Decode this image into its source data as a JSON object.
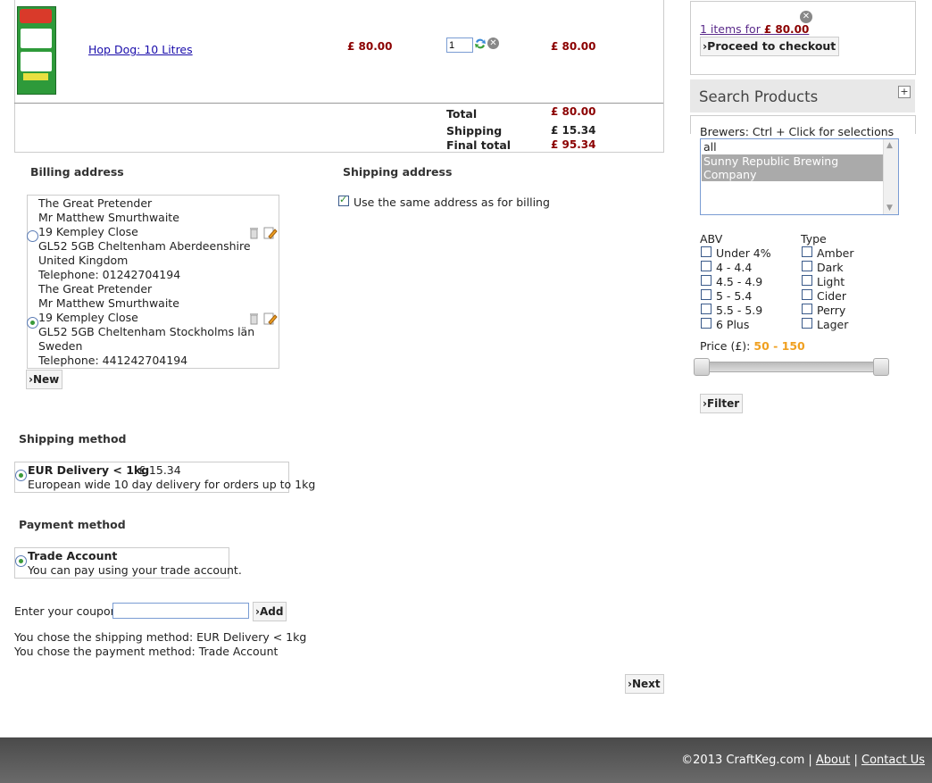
{
  "cart": {
    "product_link": "Hop Dog: 10 Litres",
    "unit_price": "£ 80.00",
    "quantity": "1",
    "line_total": "£ 80.00",
    "totals": [
      {
        "label": "Total",
        "value": "£ 80.00"
      },
      {
        "label": "Shipping",
        "value": "£ 15.34"
      },
      {
        "label": "Final total",
        "value": "£ 95.34"
      }
    ]
  },
  "billing": {
    "title": "Billing address",
    "addresses": [
      {
        "lines": [
          "The Great Pretender",
          "Mr Matthew Smurthwaite",
          "19 Kempley Close",
          "GL52 5GB Cheltenham Aberdeenshire",
          "United Kingdom",
          "Telephone: 01242704194"
        ],
        "selected": false
      },
      {
        "lines": [
          "The Great Pretender",
          "Mr Matthew Smurthwaite",
          "19 Kempley Close",
          "GL52 5GB Cheltenham Stockholms län",
          "Sweden",
          "Telephone: 441242704194"
        ],
        "selected": true
      }
    ],
    "new_label": "›New"
  },
  "shipping_address": {
    "title": "Shipping address",
    "same_as_billing_label": "Use the same address as for billing"
  },
  "shipping_method": {
    "title": "Shipping method",
    "option_name": "EUR Delivery < 1kg",
    "option_price": "£ 15.34",
    "option_desc": "European wide 10 day delivery for orders up to 1kg"
  },
  "payment_method": {
    "title": "Payment method",
    "option_name": "Trade Account",
    "option_desc": "You can pay using your trade account."
  },
  "coupon": {
    "label": "Enter your coupon",
    "value": "",
    "add_label": "›Add"
  },
  "summary": {
    "line1": "You chose the shipping method: EUR Delivery < 1kg",
    "line2": "You chose the payment method: Trade Account"
  },
  "next_label": "›Next",
  "sidebar": {
    "cart_items_link": "1 items for",
    "cart_items_total": "£ 80.00",
    "checkout_label": "›Proceed to checkout",
    "search_title": "Search Products",
    "brewers_label": "Brewers: Ctrl + Click for selections",
    "brewers": [
      "all",
      "Sunny Republic Brewing Company"
    ],
    "abv_title": "ABV",
    "abv_options": [
      "Under 4%",
      "4 - 4.4",
      "4.5 - 4.9",
      "5 - 5.4",
      "5.5 - 5.9",
      "6 Plus"
    ],
    "type_title": "Type",
    "type_options": [
      "Amber",
      "Dark",
      "Light",
      "Cider",
      "Perry",
      "Lager"
    ],
    "price_label": "Price (£):",
    "price_range": "50 - 150",
    "price_min": 50,
    "price_max": 150,
    "filter_label": "›Filter"
  },
  "footer": {
    "copyright": "©2013 CraftKeg.com |",
    "about": "About",
    "sep": "|",
    "contact": "Contact Us"
  },
  "colors": {
    "price": "#8b0000",
    "accent_orange": "#f0a020",
    "footer_bg": "#555555"
  }
}
